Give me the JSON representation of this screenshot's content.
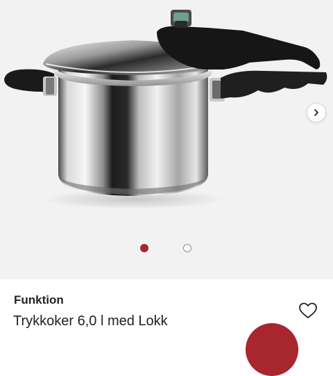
{
  "product": {
    "brand": "Funktion",
    "title": "Trykkoker 6,0 l med Lokk"
  },
  "gallery": {
    "image_count": 2,
    "active_index": 0,
    "next_icon": "chevron-right-icon"
  },
  "icons": {
    "favorite": "heart-outline-icon"
  },
  "colors": {
    "accent": "#a8262d",
    "gallery_bg": "#f2f2f2",
    "text": "#222222"
  }
}
